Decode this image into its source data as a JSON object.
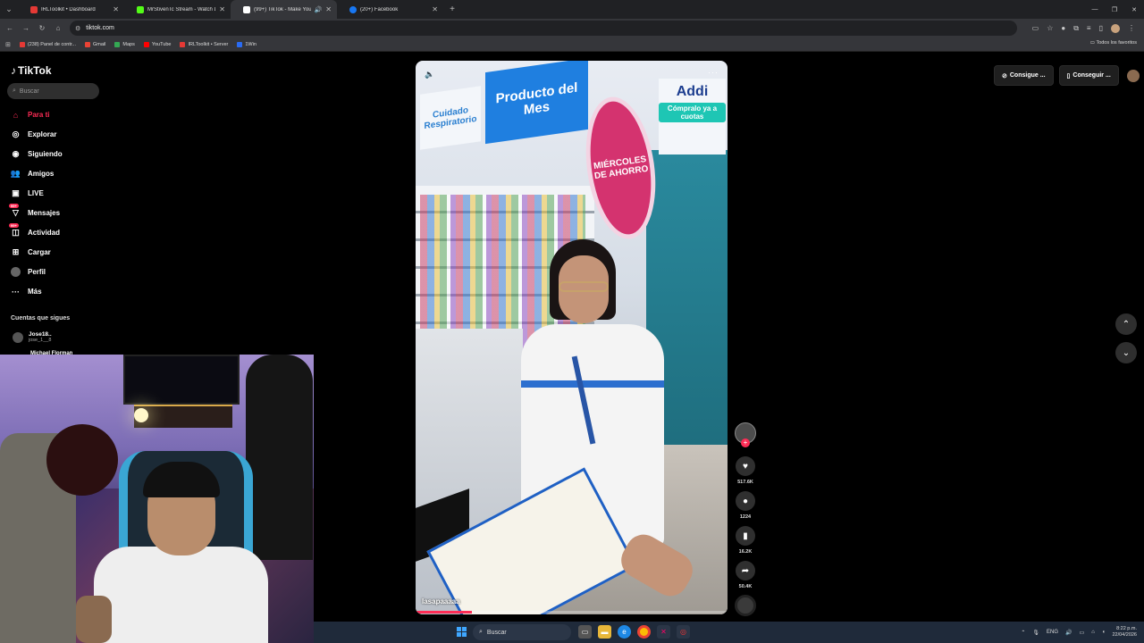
{
  "browser": {
    "tabs": [
      {
        "title": "IRLToolkit • Dashboard",
        "color": "#e53935",
        "active": false
      },
      {
        "title": "MrStivenTc Stream - Watch Live",
        "color": "#53fc18",
        "active": false
      },
      {
        "title": "(99+) TikTok - Make Your Day",
        "color": "#ffffff",
        "active": true
      },
      {
        "title": "(20+) Facebook",
        "color": "#1877f2",
        "active": false
      }
    ],
    "url": "tiktok.com",
    "bookmarks": [
      {
        "label": "(238) Panel de contr...",
        "color": "#e53935"
      },
      {
        "label": "Gmail",
        "color": "#ea4335"
      },
      {
        "label": "Maps",
        "color": "#34a853"
      },
      {
        "label": "YouTube",
        "color": "#ff0000"
      },
      {
        "label": "IRLToolkit • Server",
        "color": "#e53935"
      },
      {
        "label": "1Win",
        "color": "#2a6bf2"
      }
    ],
    "all_bookmarks": "Todos los favoritos"
  },
  "tiktok": {
    "logo": "TikTok",
    "search_placeholder": "Buscar",
    "nav": [
      {
        "label": "Para ti",
        "icon": "home-icon",
        "active": true
      },
      {
        "label": "Explorar",
        "icon": "compass-icon"
      },
      {
        "label": "Siguiendo",
        "icon": "following-icon"
      },
      {
        "label": "Amigos",
        "icon": "friends-icon"
      },
      {
        "label": "LIVE",
        "icon": "live-icon"
      },
      {
        "label": "Mensajes",
        "icon": "messages-icon",
        "badge": "99+"
      },
      {
        "label": "Actividad",
        "icon": "activity-icon",
        "badge": "99+"
      },
      {
        "label": "Cargar",
        "icon": "upload-icon"
      },
      {
        "label": "Perfil",
        "icon": "profile-icon"
      },
      {
        "label": "Más",
        "icon": "more-icon"
      }
    ],
    "following_header": "Cuentas que sigues",
    "following": [
      {
        "name": "Jose18..",
        "handle": "jose_1__8"
      },
      {
        "name": "Michael Florman"
      }
    ],
    "top_buttons": [
      "Consigue ...",
      "Conseguir ..."
    ],
    "video": {
      "caption": "lasapaaaaa",
      "progress": 0.18,
      "signs": {
        "cuidado": "Cuidado Respiratorio",
        "producto": "Producto del Mes",
        "addi": "Addi",
        "cuotas": "Cómpralo ya a cuotas",
        "miercoles": "MIÉRCOLES DE AHORRO"
      }
    },
    "actions": {
      "likes": "517.6K",
      "comments": "1224",
      "saves": "16.2K",
      "shares": "50.4K"
    }
  },
  "taskbar": {
    "search": "Buscar",
    "lang": "ENG",
    "time": "8:22 p.m.",
    "date": "22/04/2026"
  }
}
